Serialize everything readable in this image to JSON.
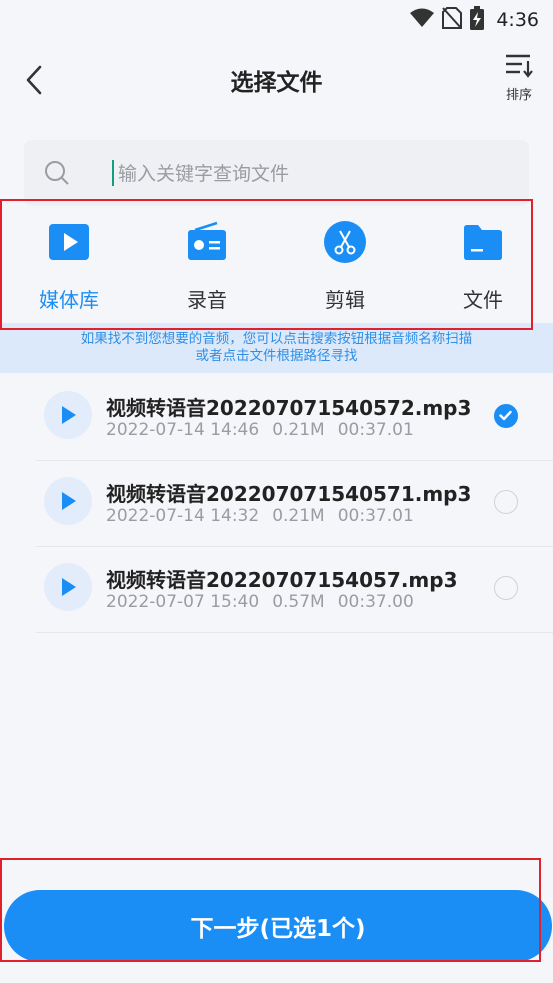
{
  "status_bar": {
    "time": "4:36",
    "icons": [
      "wifi-icon",
      "no-sim-icon",
      "battery-charging-icon"
    ]
  },
  "header": {
    "title": "选择文件",
    "sort_label": "排序",
    "back_icon": "chevron-left-icon",
    "sort_icon": "sort-icon"
  },
  "search": {
    "placeholder": "输入关键字查询文件",
    "value": ""
  },
  "tabs": [
    {
      "label": "媒体库",
      "icon": "play-box-icon",
      "active": true
    },
    {
      "label": "录音",
      "icon": "radio-icon",
      "active": false
    },
    {
      "label": "剪辑",
      "icon": "scissors-icon",
      "active": false
    },
    {
      "label": "文件",
      "icon": "folder-icon",
      "active": false
    }
  ],
  "notice": {
    "line1": "如果找不到您想要的音频，您可以点击搜索按钮根据音频名称扫描",
    "line2": "或者点击文件根据路径寻找"
  },
  "files": [
    {
      "name": "视频转语音202207071540572.mp3",
      "date": "2022-07-14 14:46",
      "size": "0.21M",
      "duration": "00:37.01",
      "selected": true
    },
    {
      "name": "视频转语音202207071540571.mp3",
      "date": "2022-07-14 14:32",
      "size": "0.21M",
      "duration": "00:37.01",
      "selected": false
    },
    {
      "name": "视频转语音20220707154057.mp3",
      "date": "2022-07-07 15:40",
      "size": "0.57M",
      "duration": "00:37.00",
      "selected": false
    }
  ],
  "next_button": {
    "label": "下一步(已选1个)"
  },
  "colors": {
    "accent": "#1a8ef5",
    "background": "#f5f6fa",
    "highlight": "#e0202b"
  }
}
